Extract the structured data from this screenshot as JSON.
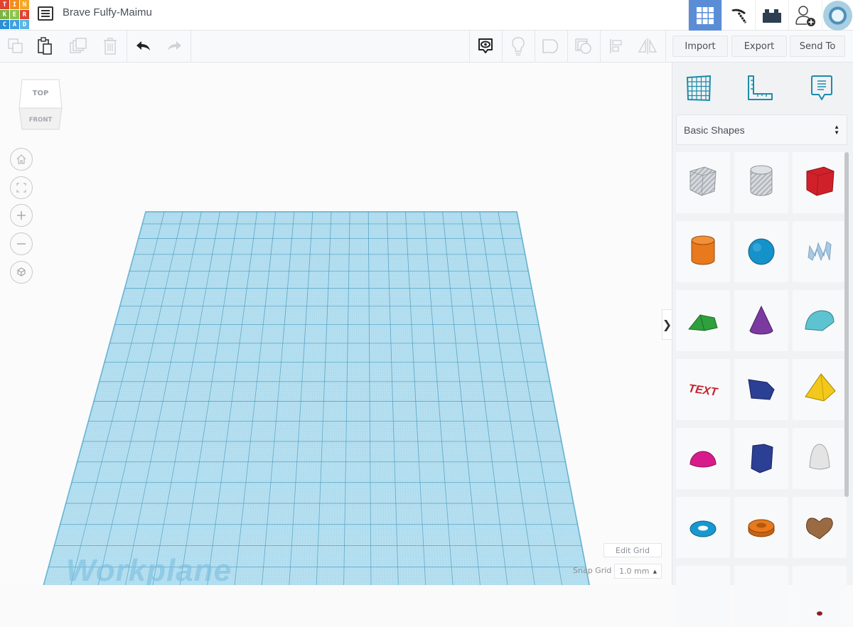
{
  "app": {
    "logo_letters": [
      "T",
      "I",
      "N",
      "K",
      "E",
      "R",
      "C",
      "A",
      "D"
    ],
    "logo_colors": [
      "#e0432f",
      "#f08c1d",
      "#f5a623",
      "#7cb342",
      "#8bc34a",
      "#e0432f",
      "#2b8fd6",
      "#3ea0dd",
      "#5ab4e5"
    ],
    "design_title": "Brave Fulfy-Maimu"
  },
  "top_nav": {
    "items": [
      {
        "name": "3d-design-view-icon",
        "active": true
      },
      {
        "name": "minecraft-pickaxe-icon",
        "active": false
      },
      {
        "name": "lego-brick-icon",
        "active": false
      },
      {
        "name": "invite-user-icon",
        "active": false
      },
      {
        "name": "user-avatar",
        "active": false
      }
    ],
    "accent_color": "#5b8dd6"
  },
  "toolbar": {
    "left_tools": [
      "copy",
      "paste",
      "duplicate",
      "delete",
      "undo",
      "redo"
    ],
    "right_tools": [
      "notes-toggle",
      "light",
      "shape-group",
      "shape-union",
      "align",
      "mirror"
    ],
    "import_label": "Import",
    "export_label": "Export",
    "send_to_label": "Send To"
  },
  "viewport": {
    "viewcube": {
      "top_label": "TOP",
      "front_label": "FRONT"
    },
    "nav_buttons": [
      "home-view",
      "fit-all",
      "zoom-in",
      "zoom-out",
      "perspective-toggle"
    ],
    "workplane_label": "Workplane",
    "edit_grid_label": "Edit Grid",
    "snap_grid_label": "Snap Grid",
    "snap_grid_value": "1.0 mm",
    "collapse_label": "❯"
  },
  "panel": {
    "top_icons": [
      "workplane-icon",
      "ruler-icon",
      "notes-icon"
    ],
    "category_select": "Basic Shapes",
    "shapes": [
      {
        "name": "box-hole",
        "color": "#c8ccd2"
      },
      {
        "name": "cylinder-hole",
        "color": "#c8ccd2"
      },
      {
        "name": "box",
        "color": "#d0212a"
      },
      {
        "name": "cylinder",
        "color": "#e8791c"
      },
      {
        "name": "sphere",
        "color": "#1592c9"
      },
      {
        "name": "scribble",
        "color": "#a9c9e3"
      },
      {
        "name": "roof",
        "color": "#2ea03c"
      },
      {
        "name": "cone",
        "color": "#7a3aa0"
      },
      {
        "name": "round-roof",
        "color": "#5ec3d1"
      },
      {
        "name": "text",
        "color": "#c8232c"
      },
      {
        "name": "wedge",
        "color": "#2b3f94"
      },
      {
        "name": "pyramid",
        "color": "#f2c81c"
      },
      {
        "name": "half-sphere",
        "color": "#d81b8a"
      },
      {
        "name": "polygon",
        "color": "#2b3f94"
      },
      {
        "name": "paraboloid",
        "color": "#e4e4e4"
      },
      {
        "name": "torus",
        "color": "#1798cf"
      },
      {
        "name": "tube",
        "color": "#e8791c"
      },
      {
        "name": "heart",
        "color": "#9a6a42"
      },
      {
        "name": "more-shape-1",
        "color": "#cccccc"
      },
      {
        "name": "more-shape-2",
        "color": "#cccccc"
      },
      {
        "name": "more-shape-3",
        "color": "#8a1f2a"
      }
    ]
  }
}
